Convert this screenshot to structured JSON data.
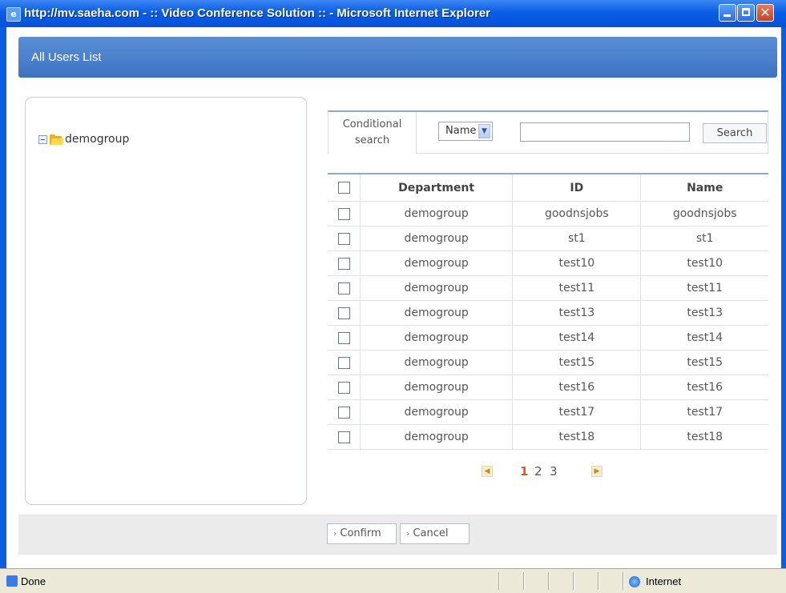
{
  "window": {
    "title": "http://mv.saeha.com - :: Video Conference Solution :: - Microsoft Internet Explorer"
  },
  "header": {
    "title": "All Users List"
  },
  "tree": {
    "root_label": "demogroup"
  },
  "search": {
    "label_line1": "Conditional",
    "label_line2": "search",
    "field_selected": "Name",
    "query": "",
    "button_label": "Search"
  },
  "table": {
    "columns": [
      "Department",
      "ID",
      "Name"
    ],
    "rows": [
      {
        "department": "demogroup",
        "id": "goodnsjobs",
        "name": "goodnsjobs"
      },
      {
        "department": "demogroup",
        "id": "st1",
        "name": "st1"
      },
      {
        "department": "demogroup",
        "id": "test10",
        "name": "test10"
      },
      {
        "department": "demogroup",
        "id": "test11",
        "name": "test11"
      },
      {
        "department": "demogroup",
        "id": "test13",
        "name": "test13"
      },
      {
        "department": "demogroup",
        "id": "test14",
        "name": "test14"
      },
      {
        "department": "demogroup",
        "id": "test15",
        "name": "test15"
      },
      {
        "department": "demogroup",
        "id": "test16",
        "name": "test16"
      },
      {
        "department": "demogroup",
        "id": "test17",
        "name": "test17"
      },
      {
        "department": "demogroup",
        "id": "test18",
        "name": "test18"
      }
    ]
  },
  "pagination": {
    "pages": [
      "1",
      "2",
      "3"
    ],
    "current": "1"
  },
  "footer": {
    "confirm_label": "Confirm",
    "cancel_label": "Cancel"
  },
  "statusbar": {
    "status": "Done",
    "zone": "Internet"
  },
  "colors": {
    "accent": "#3d73c4",
    "current_page": "#e05a16",
    "titlebar": "#0a5ee6"
  }
}
